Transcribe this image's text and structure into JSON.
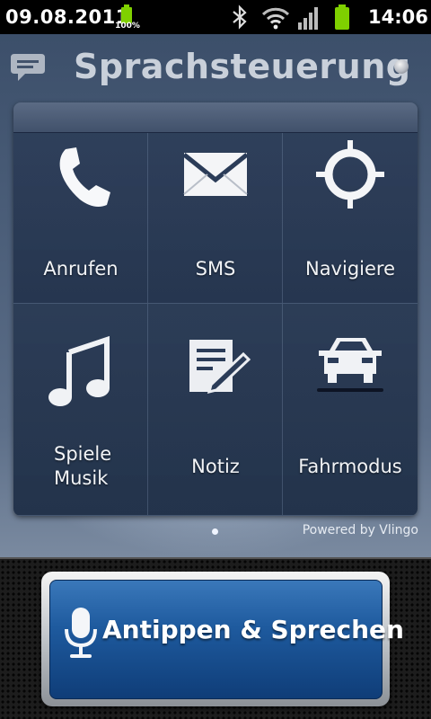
{
  "status_bar": {
    "date": "09.08.2011",
    "small_battery_label": "100%",
    "time": "14:06",
    "icons": [
      "battery-small-icon",
      "bluetooth-icon",
      "wifi-icon",
      "signal-icon",
      "battery-icon"
    ],
    "battery_color": "#7fd000"
  },
  "header": {
    "title": "Sprachsteuerung",
    "icon": "chat-bubble-icon"
  },
  "grid": {
    "items": [
      {
        "label": "Anrufen",
        "icon": "phone-icon"
      },
      {
        "label": "SMS",
        "icon": "envelope-icon"
      },
      {
        "label": "Navigiere",
        "icon": "crosshair-icon"
      },
      {
        "label_line1": "Spiele",
        "label_line2": "Musik",
        "icon": "music-note-icon"
      },
      {
        "label": "Notiz",
        "icon": "note-icon"
      },
      {
        "label": "Fahrmodus",
        "icon": "car-icon"
      }
    ]
  },
  "footer": {
    "powered_by": "Powered by Vlingo"
  },
  "speak_button": {
    "label": "Antippen & Sprechen",
    "icon": "microphone-icon",
    "color": "#1e5a9e"
  }
}
